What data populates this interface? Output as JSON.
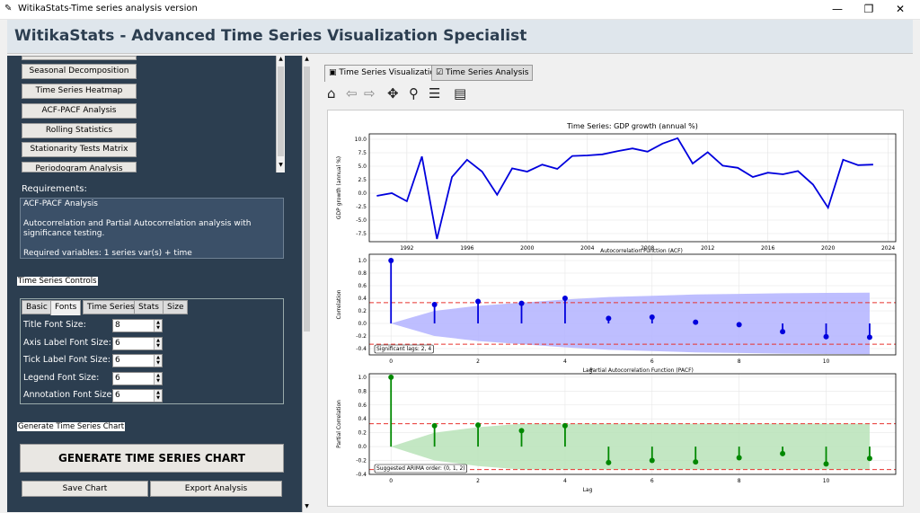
{
  "window": {
    "title": "WitikaStats-Time series analysis version",
    "minimize": "—",
    "maximize": "❐",
    "close": "✕"
  },
  "header": {
    "title": "WitikaStats - Advanced Time Series Visualization Specialist"
  },
  "sidebar": {
    "buttons": [
      "Seasonal Decomposition",
      "Time Series Heatmap",
      "ACF-PACF Analysis",
      "Rolling Statistics",
      "Stationarity Tests Matrix",
      "Periodogram Analysis"
    ],
    "requirements_label": "Requirements:",
    "requirements_title": "ACF-PACF Analysis",
    "requirements_desc": "Autocorrelation and Partial Autocorrelation analysis with significance testing.",
    "requirements_vars": "Required variables: 1 series var(s) + time"
  },
  "controls": {
    "label": "Time Series Controls",
    "tabs": [
      "Basic",
      "Fonts",
      "Time Series",
      "Stats",
      "Size"
    ],
    "fields": [
      {
        "label": "Title Font Size:",
        "value": "8"
      },
      {
        "label": "Axis Label Font Size:",
        "value": "6"
      },
      {
        "label": "Tick Label Font Size:",
        "value": "6"
      },
      {
        "label": "Legend Font Size:",
        "value": "6"
      },
      {
        "label": "Annotation Font Size:",
        "value": "6"
      }
    ]
  },
  "generate": {
    "label": "Generate Time Series Chart",
    "button": "GENERATE TIME SERIES CHART",
    "save": "Save Chart",
    "export": "Export Analysis"
  },
  "right_tabs": [
    "Time Series Visualization",
    "Time Series Analysis"
  ],
  "toolbar_icons": [
    "home-icon",
    "back-icon",
    "forward-icon",
    "pan-icon",
    "zoom-icon",
    "configure-icon",
    "save-icon"
  ],
  "chart_data": [
    {
      "type": "line",
      "title": "Time Series: GDP growth (annual %)",
      "ylabel": "GDP growth (annual %)",
      "xlabel": "",
      "ylim": [
        -9,
        11
      ],
      "xlim": [
        1989.5,
        2024.5
      ],
      "xticks": [
        1992,
        1996,
        2000,
        2004,
        2008,
        2012,
        2016,
        2020,
        2024
      ],
      "yticks": [
        -7.5,
        -5.0,
        -2.5,
        0.0,
        2.5,
        5.0,
        7.5,
        10.0
      ],
      "x": [
        1990,
        1991,
        1992,
        1993,
        1994,
        1995,
        1996,
        1997,
        1998,
        1999,
        2000,
        2001,
        2002,
        2003,
        2004,
        2005,
        2006,
        2007,
        2008,
        2009,
        2010,
        2011,
        2012,
        2013,
        2014,
        2015,
        2016,
        2017,
        2018,
        2019,
        2020,
        2021,
        2022,
        2023
      ],
      "y": [
        -0.5,
        0,
        -1.5,
        6.8,
        -8.5,
        3,
        6.2,
        4,
        -0.3,
        4.6,
        4,
        5.3,
        4.5,
        6.9,
        7,
        7.2,
        7.8,
        8.3,
        7.7,
        9.2,
        10.2,
        5.5,
        7.6,
        5.1,
        4.7,
        3,
        3.8,
        3.5,
        4.1,
        1.6,
        -2.7,
        6.2,
        5.2,
        5.3
      ],
      "color": "#0000dd"
    },
    {
      "type": "stem",
      "title": "Autocorrelation Function (ACF)",
      "ylabel": "Correlation",
      "xlabel": "Lag",
      "ylim": [
        -0.5,
        1.1
      ],
      "xticks": [
        0,
        2,
        4,
        6,
        8,
        10
      ],
      "yticks": [
        -0.4,
        -0.2,
        0.0,
        0.2,
        0.4,
        0.6,
        0.8,
        1.0
      ],
      "x": [
        0,
        1,
        2,
        3,
        4,
        5,
        6,
        7,
        8,
        9,
        10,
        11
      ],
      "y": [
        1.0,
        0.3,
        0.35,
        0.32,
        0.4,
        0.08,
        0.1,
        0.02,
        -0.02,
        -0.13,
        -0.21,
        -0.22
      ],
      "conf": 0.33,
      "band_max": 0.49,
      "annotation": "Significant lags: 2, 4",
      "color": "#0000dd",
      "fill": "#b3b3ff"
    },
    {
      "type": "stem",
      "title": "Partial Autocorrelation Function (PACF)",
      "ylabel": "Partial Correlation",
      "xlabel": "Lag",
      "ylim": [
        -0.4,
        1.05
      ],
      "xticks": [
        0,
        2,
        4,
        6,
        8,
        10
      ],
      "yticks": [
        -0.4,
        -0.2,
        0.0,
        0.2,
        0.4,
        0.6,
        0.8,
        1.0
      ],
      "x": [
        0,
        1,
        2,
        3,
        4,
        5,
        6,
        7,
        8,
        9,
        10,
        11
      ],
      "y": [
        1.0,
        0.3,
        0.31,
        0.23,
        0.3,
        -0.23,
        -0.2,
        -0.22,
        -0.16,
        -0.1,
        -0.25,
        -0.17
      ],
      "conf": 0.33,
      "band_max": 0.33,
      "annotation": "Suggested ARIMA order: (0, 1, 2)",
      "color": "#008800",
      "fill": "#b9e3b9"
    }
  ]
}
